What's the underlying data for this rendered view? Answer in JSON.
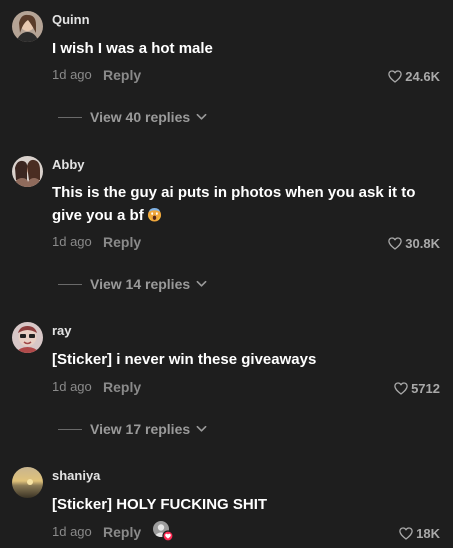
{
  "comments": [
    {
      "username": "Quinn",
      "text": "I wish I was a hot male",
      "time": "1d ago",
      "reply_label": "Reply",
      "likes": "24.6K",
      "view_replies": "View 40 replies"
    },
    {
      "username": "Abby",
      "text": "This is the guy ai puts in photos when you ask it to give you a bf",
      "emoji": "screaming-face-emoji",
      "time": "1d ago",
      "reply_label": "Reply",
      "likes": "30.8K",
      "view_replies": "View 14 replies"
    },
    {
      "username": "ray",
      "text": "[Sticker] i never win these giveaways",
      "time": "1d ago",
      "reply_label": "Reply",
      "likes": "5712",
      "view_replies": "View 17 replies"
    },
    {
      "username": "shaniya",
      "text": "[Sticker] HOLY FUCKING SHIT",
      "time": "1d ago",
      "reply_label": "Reply",
      "likes": "18K",
      "creator_liked": true
    }
  ],
  "colors": {
    "background": "#1e1e1e",
    "meta_text": "#8a8a8a",
    "like_badge": "#fe2c55"
  },
  "icons": {
    "like": "heart-outline-icon",
    "expand": "chevron-down-icon",
    "creator_liked": "creator-liked-avatar-icon"
  }
}
